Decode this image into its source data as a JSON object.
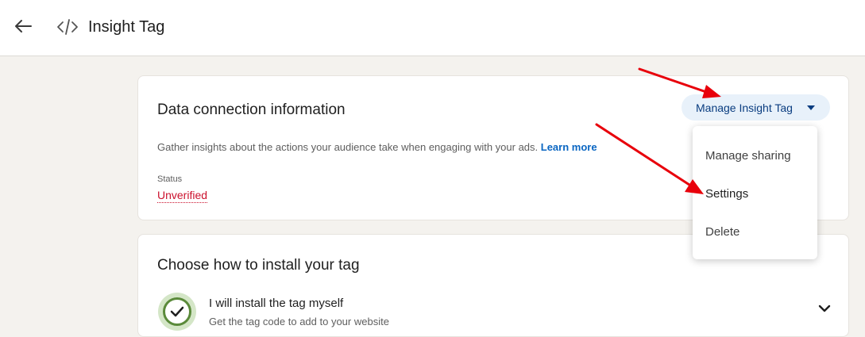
{
  "header": {
    "title": "Insight Tag",
    "back_icon": "arrow-left-icon",
    "tag_icon": "code-icon"
  },
  "data_connection": {
    "title": "Data connection information",
    "description": "Gather insights about the actions your audience take when engaging with your ads.",
    "learn_more": "Learn more",
    "status_label": "Status",
    "status_value": "Unverified"
  },
  "manage_button": {
    "label": "Manage Insight Tag",
    "icon": "caret-down-icon"
  },
  "dropdown_menu": {
    "items": [
      {
        "label": "Manage sharing"
      },
      {
        "label": "Settings"
      },
      {
        "label": "Delete"
      }
    ]
  },
  "install": {
    "title": "Choose how to install your tag",
    "option_title": "I will install the tag myself",
    "option_subtitle": "Get the tag code to add to your website"
  },
  "colors": {
    "accent": "#0a66c2",
    "status_error": "#cb112d",
    "annotation_arrow": "#e8000b"
  }
}
